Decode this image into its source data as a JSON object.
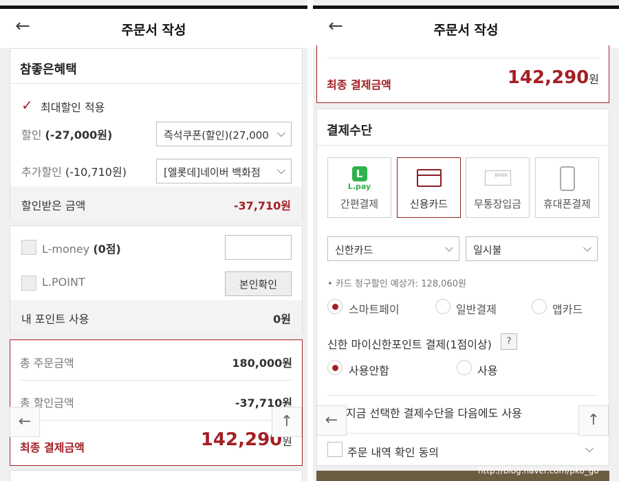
{
  "left": {
    "header": {
      "back_icon": "←",
      "title": "주문서 작성"
    },
    "benefit": {
      "title": "참좋은혜택",
      "max_discount_label": "최대할인 적용",
      "discount_label": "할인",
      "discount_amount": "(-27,000원)",
      "discount_select": "즉석쿠폰(할인)(27,000",
      "extra_label": "추가할인",
      "extra_amount": "(-10,710원)",
      "extra_select": "[엘롯데]네이버 백화점",
      "received_label": "할인받은 금액",
      "received_value": "-37,710원"
    },
    "points": {
      "lmoney_label": "L-money",
      "lmoney_count": "(0점)",
      "lpoint_label": "L.POINT",
      "verify_button": "본인확인",
      "use_label": "내 포인트 사용",
      "use_value": "0원"
    },
    "summary": {
      "total_order_label": "총 주문금액",
      "total_order_value": "180,000원",
      "total_discount_label": "총 할인금액",
      "total_discount_value": "-37,710원",
      "final_label": "최종 결제금액",
      "final_value": "142,290",
      "final_unit": "원"
    },
    "float_back": "←",
    "float_up": "↑"
  },
  "right": {
    "header": {
      "back_icon": "←",
      "title": "주문서 작성"
    },
    "final": {
      "label": "최종 결제금액",
      "value": "142,290",
      "unit": "원"
    },
    "payment": {
      "title": "결제수단",
      "methods": [
        {
          "label": "간편결제",
          "icon_text": "L.pay"
        },
        {
          "label": "신용카드"
        },
        {
          "label": "무통장입금",
          "icon_text": "BANK"
        },
        {
          "label": "휴대폰결제"
        }
      ],
      "card_select": "신한카드",
      "installment_select": "일시불",
      "expected_note": "• 카드 청구할인 예상가: 128,060원",
      "options": [
        "스마트페이",
        "일반결제",
        "앱카드"
      ],
      "point_question": "신한 마이신한포인트 결제(1점이상)",
      "help_icon": "?",
      "point_options": [
        "사용안함",
        "사용"
      ],
      "save_method_label": "지금 선택한 결제수단을 다음에도 사용",
      "agree_label": "주문 내역 확인 동의"
    },
    "float_back": "←",
    "float_up": "↑",
    "watermark": "http://blog.naver.com/pko_go"
  }
}
